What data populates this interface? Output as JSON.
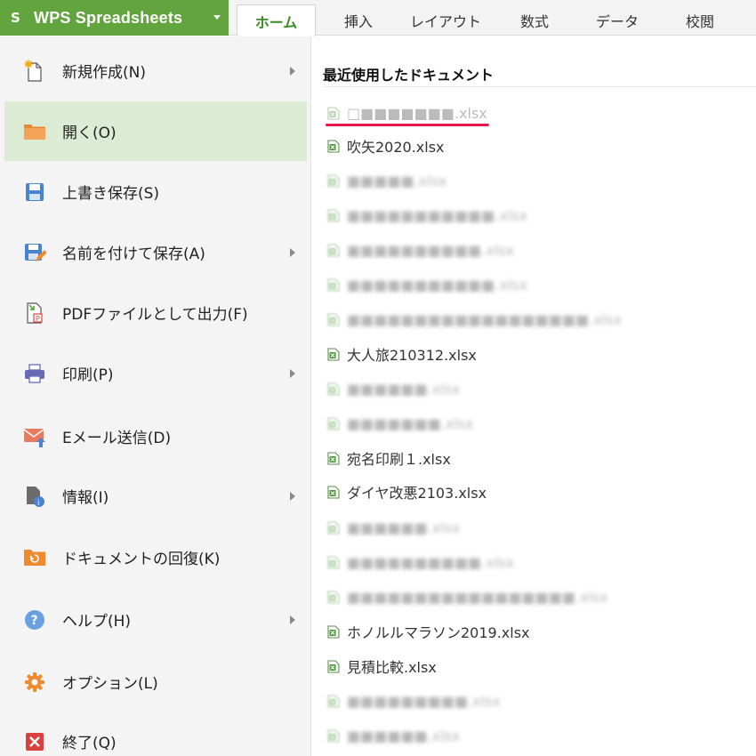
{
  "app": {
    "title": "WPS Spreadsheets",
    "logo_glyph": "S",
    "brand_color": "#62a43e"
  },
  "tabs": [
    {
      "label": "ホーム",
      "active": true
    },
    {
      "label": "挿入"
    },
    {
      "label": "レイアウト"
    },
    {
      "label": "数式"
    },
    {
      "label": "データ"
    },
    {
      "label": "校閲"
    }
  ],
  "menu": {
    "items": [
      {
        "label": "新規作成(N)",
        "icon": "new-document-icon",
        "submenu": true
      },
      {
        "label": "開く(O)",
        "icon": "folder-open-icon",
        "active": true
      },
      {
        "label": "上書き保存(S)",
        "icon": "save-icon"
      },
      {
        "label": "名前を付けて保存(A)",
        "icon": "save-as-icon",
        "submenu": true
      },
      {
        "label": "PDFファイルとして出力(F)",
        "icon": "pdf-export-icon"
      },
      {
        "label": "印刷(P)",
        "icon": "printer-icon",
        "submenu": true
      },
      {
        "label": "Eメール送信(D)",
        "icon": "email-icon"
      },
      {
        "label": "情報(I)",
        "icon": "info-document-icon",
        "submenu": true
      },
      {
        "label": "ドキュメントの回復(K)",
        "icon": "recover-folder-icon"
      },
      {
        "label": "ヘルプ(H)",
        "icon": "help-icon",
        "submenu": true
      },
      {
        "label": "オプション(L)",
        "icon": "gear-icon"
      },
      {
        "label": "終了(Q)",
        "icon": "exit-icon"
      }
    ]
  },
  "recent": {
    "heading": "最近使用したドキュメント",
    "files": [
      {
        "name": "□■■■■■■■.xlsx",
        "state": "faded"
      },
      {
        "name": "吹矢2020.xlsx",
        "state": "normal"
      },
      {
        "name": "■■■■■.xlsx",
        "state": "blurred"
      },
      {
        "name": "■■■■■■■■■■■.xlsx",
        "state": "blurred"
      },
      {
        "name": "■■■■■■■■■■.xlsx",
        "state": "blurred"
      },
      {
        "name": "■■■■■■■■■■■.xlsx",
        "state": "blurred"
      },
      {
        "name": "■■■■■■■■■■■■■■■■■■.xlsx",
        "state": "blurred"
      },
      {
        "name": "大人旅210312.xlsx",
        "state": "normal"
      },
      {
        "name": "■■■■■■.xlsx",
        "state": "blurred"
      },
      {
        "name": "■■■■■■■.xlsx",
        "state": "blurred"
      },
      {
        "name": "宛名印刷１.xlsx",
        "state": "normal"
      },
      {
        "name": "ダイヤ改悪2103.xlsx",
        "state": "normal"
      },
      {
        "name": "■■■■■■.xlsx",
        "state": "blurred"
      },
      {
        "name": "■■■■■■■■■■.xlsx",
        "state": "blurred"
      },
      {
        "name": "■■■■■■■■■■■■■■■■■.xlsx",
        "state": "blurred"
      },
      {
        "name": "ホノルルマラソン2019.xlsx",
        "state": "normal"
      },
      {
        "name": "見積比較.xlsx",
        "state": "normal"
      },
      {
        "name": "■■■■■■■■■.xlsx",
        "state": "blurred"
      },
      {
        "name": "■■■■■■.xlsx",
        "state": "blurred"
      }
    ]
  },
  "colors": {
    "active_tab_text": "#3e8a24",
    "active_menu_bg": "#dcebd3",
    "annotation_underline": "#e8194a"
  }
}
